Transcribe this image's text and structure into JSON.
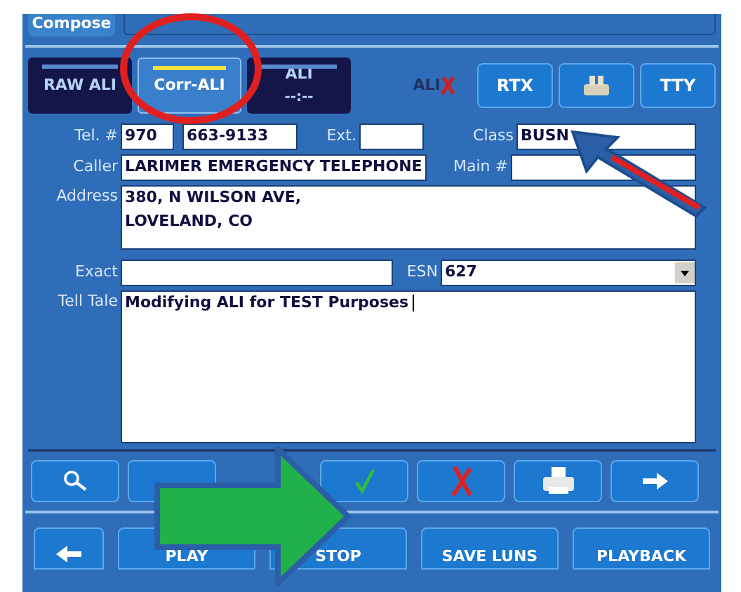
{
  "top_bar": {
    "compose_label": "Compose"
  },
  "tabs": [
    {
      "label": "RAW ALI",
      "selected": false
    },
    {
      "label": "Corr-ALI",
      "selected": true
    },
    {
      "label": "ALI",
      "sublabel": "--:--",
      "selected": false
    }
  ],
  "tool_buttons": [
    {
      "kind": "ali-x",
      "label": "ALI"
    },
    {
      "kind": "text",
      "label": "RTX"
    },
    {
      "kind": "phone"
    },
    {
      "kind": "text",
      "label": "TTY"
    }
  ],
  "form": {
    "tel_label": "Tel. #",
    "tel_area": "970",
    "tel_number": "663-9133",
    "ext_label": "Ext.",
    "class_label": "Class",
    "class_value": "BUSN",
    "caller_label": "Caller",
    "caller_value": "LARIMER EMERGENCY TELEPHONE",
    "main_label": "Main #",
    "address_label": "Address",
    "address_lines": [
      "380, N WILSON AVE,",
      "LOVELAND, CO"
    ],
    "exact_label": "Exact",
    "esn_label": "ESN",
    "esn_value": "627",
    "tell_tale_label": "Tell Tale",
    "tell_tale_value": "Modifying ALI for TEST Purposes"
  },
  "action_buttons": [
    {
      "kind": "search"
    },
    {
      "kind": "blank"
    },
    {
      "kind": "check"
    },
    {
      "kind": "cross"
    },
    {
      "kind": "print"
    },
    {
      "kind": "next"
    }
  ],
  "bottom_buttons": [
    {
      "kind": "back"
    },
    {
      "kind": "text",
      "label": "PLAY"
    },
    {
      "kind": "text",
      "label": "STOP"
    },
    {
      "kind": "text",
      "label": "SAVE LUNS"
    },
    {
      "kind": "text",
      "label": "PLAYBACK"
    }
  ]
}
